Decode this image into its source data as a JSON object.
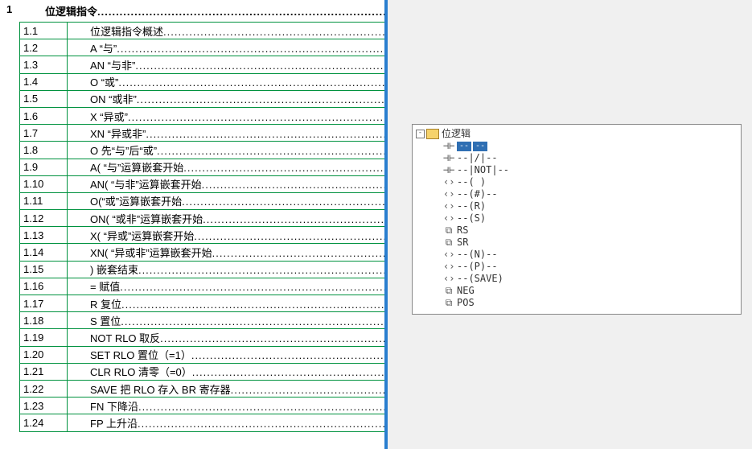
{
  "toc": {
    "chapter_no": "1",
    "chapter_title": "位逻辑指令",
    "sections": [
      {
        "no": "1.1",
        "txt": "位逻辑指令概述"
      },
      {
        "no": "1.2",
        "txt": "A   “与”"
      },
      {
        "no": "1.3",
        "txt": "AN   “与非”"
      },
      {
        "no": "1.4",
        "txt": "O   “或”"
      },
      {
        "no": "1.5",
        "txt": "ON   “或非”"
      },
      {
        "no": "1.6",
        "txt": "X    “异或”"
      },
      {
        "no": "1.7",
        "txt": "XN   “异或非”"
      },
      {
        "no": "1.8",
        "txt": "O   先“与”后“或”"
      },
      {
        "no": "1.9",
        "txt": "A(   “与”运算嵌套开始"
      },
      {
        "no": "1.10",
        "txt": "AN(   “与非”运算嵌套开始"
      },
      {
        "no": "1.11",
        "txt": "O(“或”运算嵌套开始"
      },
      {
        "no": "1.12",
        "txt": "ON(   “或非”运算嵌套开始"
      },
      {
        "no": "1.13",
        "txt": "X(  “异或”运算嵌套开始"
      },
      {
        "no": "1.14",
        "txt": "XN(   “异或非”运算嵌套开始"
      },
      {
        "no": "1.15",
        "txt": ")   嵌套结束"
      },
      {
        "no": "1.16",
        "txt": "=   赋值"
      },
      {
        "no": "1.17",
        "txt": "R   复位"
      },
      {
        "no": "1.18",
        "txt": "S  置位"
      },
      {
        "no": "1.19",
        "txt": "NOT    RLO 取反"
      },
      {
        "no": "1.20",
        "txt": "SET    RLO 置位（=1）"
      },
      {
        "no": "1.21",
        "txt": "CLR    RLO 清零（=0）"
      },
      {
        "no": "1.22",
        "txt": "SAVE   把 RLO 存入 BR 寄存器"
      },
      {
        "no": "1.23",
        "txt": "FN   下降沿"
      },
      {
        "no": "1.24",
        "txt": "FP   上升沿"
      }
    ]
  },
  "tree": {
    "root_label": "位逻辑",
    "highlight_badges": [
      "--",
      "--"
    ],
    "nodes": [
      {
        "icon": "contact",
        "label": "--| |--",
        "highlight": true
      },
      {
        "icon": "contact",
        "label": "--|/|--"
      },
      {
        "icon": "contact",
        "label": "--|NOT|--"
      },
      {
        "icon": "coil",
        "label": "--( )"
      },
      {
        "icon": "coil",
        "label": "--(#)--"
      },
      {
        "icon": "coil",
        "label": "--(R)"
      },
      {
        "icon": "coil",
        "label": "--(S)"
      },
      {
        "icon": "box",
        "label": "RS"
      },
      {
        "icon": "box",
        "label": "SR"
      },
      {
        "icon": "coil",
        "label": "--(N)--"
      },
      {
        "icon": "coil",
        "label": "--(P)--"
      },
      {
        "icon": "coil",
        "label": "--(SAVE)"
      },
      {
        "icon": "box",
        "label": "NEG"
      },
      {
        "icon": "box",
        "label": "POS"
      }
    ]
  }
}
